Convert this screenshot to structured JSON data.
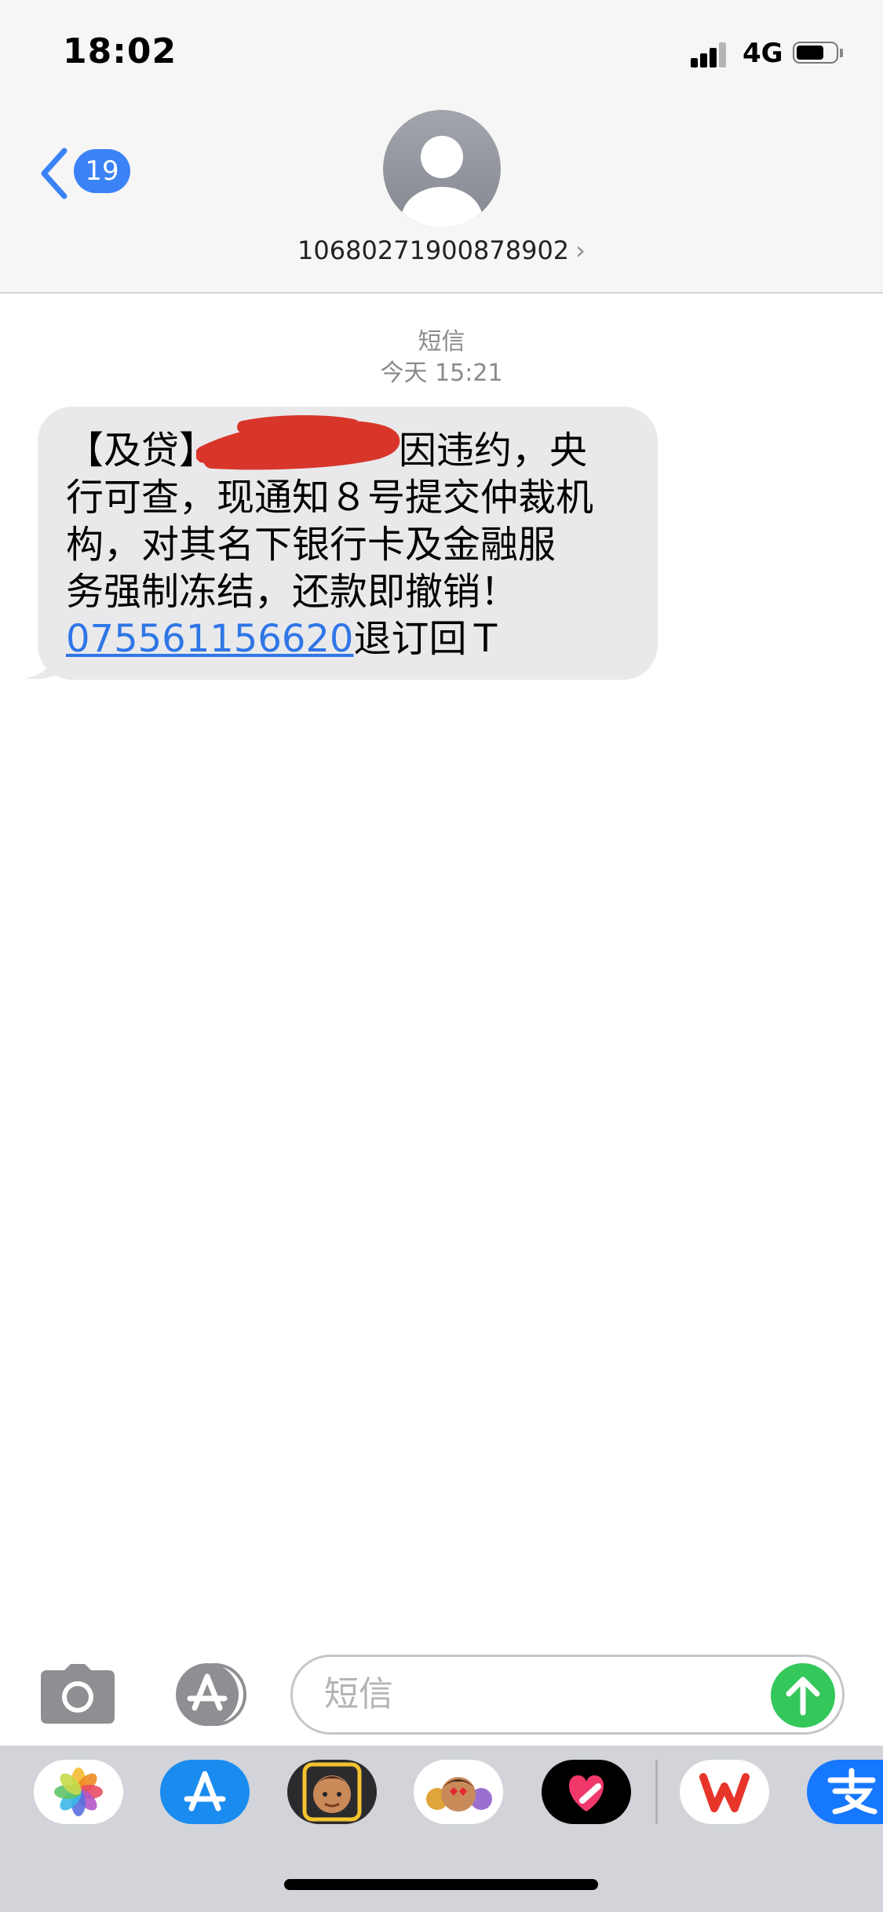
{
  "status_bar": {
    "time": "18:02",
    "network": "4G",
    "battery_level": 0.7
  },
  "header": {
    "back_badge_count": "19",
    "contact_number": "10680271900878902",
    "contact_chevron": "›"
  },
  "conversation": {
    "service_label": "短信",
    "timestamp": "今天 15:21",
    "message": {
      "lines": [
        "【及贷】",
        "因违约，央",
        "行可查，现通知８号提交仲裁机",
        "构，对其名下银行卡及金融服",
        "务强制冻结，还款即撤销！"
      ],
      "phone_link": "075561156620",
      "suffix": "退订回Ｔ"
    }
  },
  "composer": {
    "placeholder": "短信"
  },
  "colors": {
    "accent_blue": "#3b82f6",
    "send_green": "#34c759",
    "bubble_gray": "#e9e9eb",
    "redaction_red": "#d9362b"
  },
  "tray_apps": [
    "photos-icon",
    "app-store-icon",
    "memoji-face-icon",
    "memoji-stickers-icon",
    "digital-touch-icon",
    "wps-office-icon",
    "alipay-icon"
  ]
}
